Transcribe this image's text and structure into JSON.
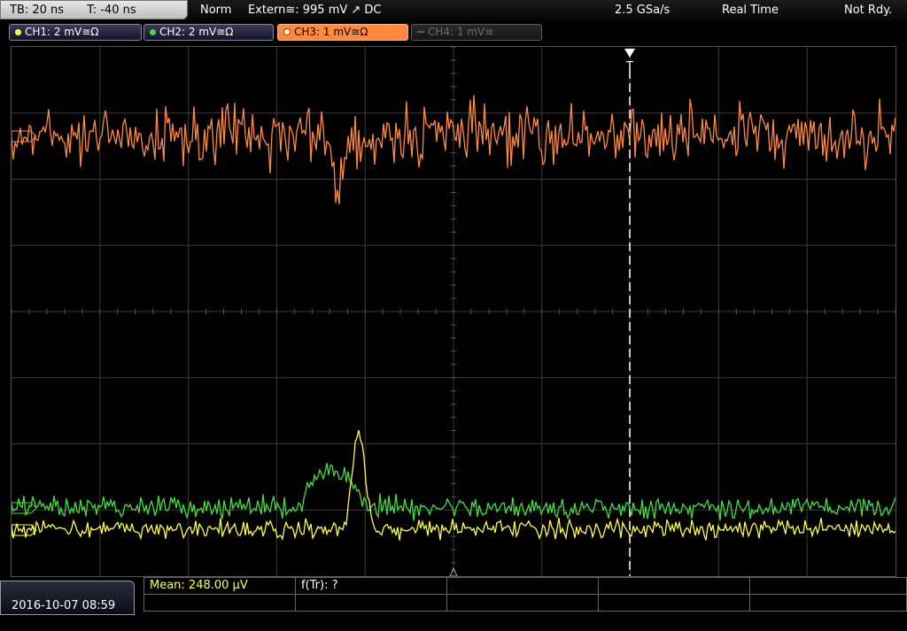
{
  "top_bar": {
    "timebase": "TB: 20 ns",
    "trigger_time": "T: -40 ns",
    "acq_mode": "Norm",
    "trigger_info": "Extern≅: 995 mV ↗ DC",
    "sample_rate": "2.5 GSa/s",
    "mode": "Real Time",
    "status": "Not Rdy."
  },
  "channels": [
    {
      "label": "CH1: 2 mV≅Ω",
      "color": "#ffff40",
      "state": "on"
    },
    {
      "label": "CH2: 2 mV≅Ω",
      "color": "#40e040",
      "state": "on"
    },
    {
      "label": "CH3: 1 mV≅Ω",
      "color": "#ff8a3d",
      "state": "active"
    },
    {
      "label": "CH4: 1 mV≅",
      "color": "#6e6e6e",
      "state": "off"
    }
  ],
  "markers": {
    "trigger_marker": "T"
  },
  "bottom": {
    "datetime": "2016-10-07 08:59",
    "measurement_1": "Mean: 248.00 µV",
    "measurement_2": "f(Tr): ?"
  },
  "colors": {
    "ch1": "#ffff40",
    "ch2": "#40e040",
    "ch3": "#ff8a3d",
    "grid": "#3a3a3a",
    "trigger_line": "#ffffff"
  }
}
